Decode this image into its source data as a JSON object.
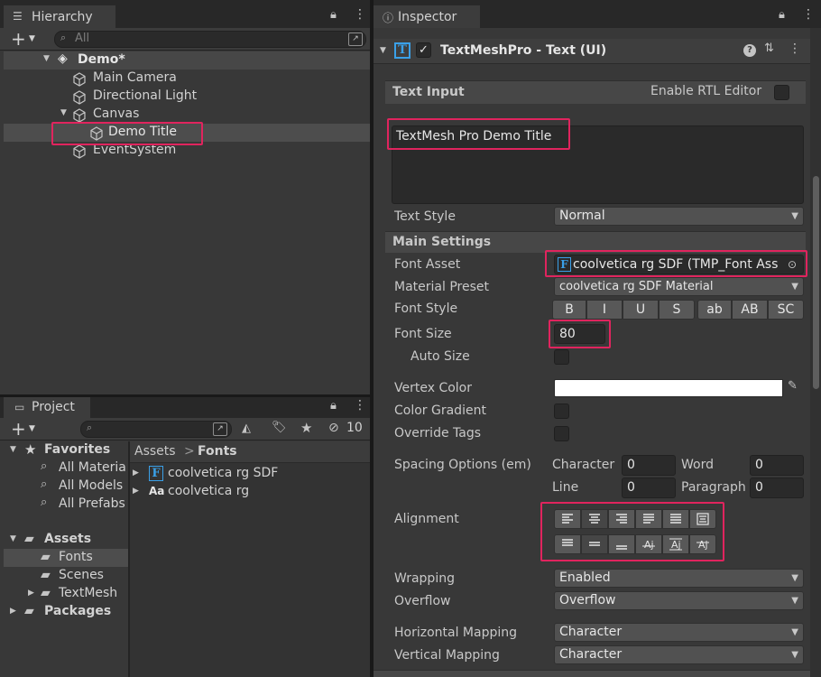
{
  "hierarchy": {
    "tab_title": "Hierarchy",
    "search_placeholder": "All",
    "scene_name": "Demo*",
    "items": [
      {
        "label": "Main Camera"
      },
      {
        "label": "Directional Light"
      },
      {
        "label": "Canvas"
      },
      {
        "label": "Demo Title"
      },
      {
        "label": "EventSystem"
      }
    ]
  },
  "project": {
    "tab_title": "Project",
    "hidden_count": "10",
    "favorites": {
      "label": "Favorites",
      "items": [
        "All Materia",
        "All Models",
        "All Prefabs"
      ]
    },
    "assets": {
      "label": "Assets",
      "items": [
        "Fonts",
        "Scenes",
        "TextMesh"
      ]
    },
    "packages_label": "Packages",
    "breadcrumb": {
      "root": "Assets",
      "sep": ">",
      "current": "Fonts"
    },
    "files": [
      {
        "icon": "F",
        "label": "coolvetica rg SDF"
      },
      {
        "icon": "Aa",
        "label": "coolvetica rg"
      }
    ]
  },
  "inspector": {
    "tab_title": "Inspector",
    "component_title": "TextMeshPro - Text (UI)",
    "text_input": {
      "header": "Text Input",
      "rtl_label": "Enable RTL Editor",
      "value": "TextMesh Pro Demo Title"
    },
    "text_style": {
      "label": "Text Style",
      "value": "Normal"
    },
    "main_settings": {
      "header": "Main Settings",
      "font_asset_label": "Font Asset",
      "font_asset_value": "coolvetica rg SDF (TMP_Font Ass",
      "material_preset_label": "Material Preset",
      "material_preset_value": "coolvetica rg SDF Material",
      "font_style_label": "Font Style",
      "font_style_buttons": [
        "B",
        "I",
        "U",
        "S",
        "ab",
        "AB",
        "SC"
      ],
      "font_size_label": "Font Size",
      "font_size_value": "80",
      "auto_size_label": "Auto Size",
      "vertex_color_label": "Vertex Color",
      "vertex_color_value": "#ffffff",
      "color_gradient_label": "Color Gradient",
      "override_tags_label": "Override Tags",
      "spacing_label": "Spacing Options (em)",
      "character_label": "Character",
      "character_value": "0",
      "word_label": "Word",
      "word_value": "0",
      "line_label": "Line",
      "line_value": "0",
      "paragraph_label": "Paragraph",
      "paragraph_value": "0",
      "alignment_label": "Alignment",
      "wrapping_label": "Wrapping",
      "wrapping_value": "Enabled",
      "overflow_label": "Overflow",
      "overflow_value": "Overflow",
      "horizontal_mapping_label": "Horizontal Mapping",
      "horizontal_mapping_value": "Character",
      "vertical_mapping_label": "Vertical Mapping",
      "vertical_mapping_value": "Character"
    }
  },
  "colors": {
    "highlight": "#e0245e",
    "panel_bg": "#383838",
    "selected_row": "#4d4d4d",
    "accent_blue": "#3aa0e8"
  }
}
